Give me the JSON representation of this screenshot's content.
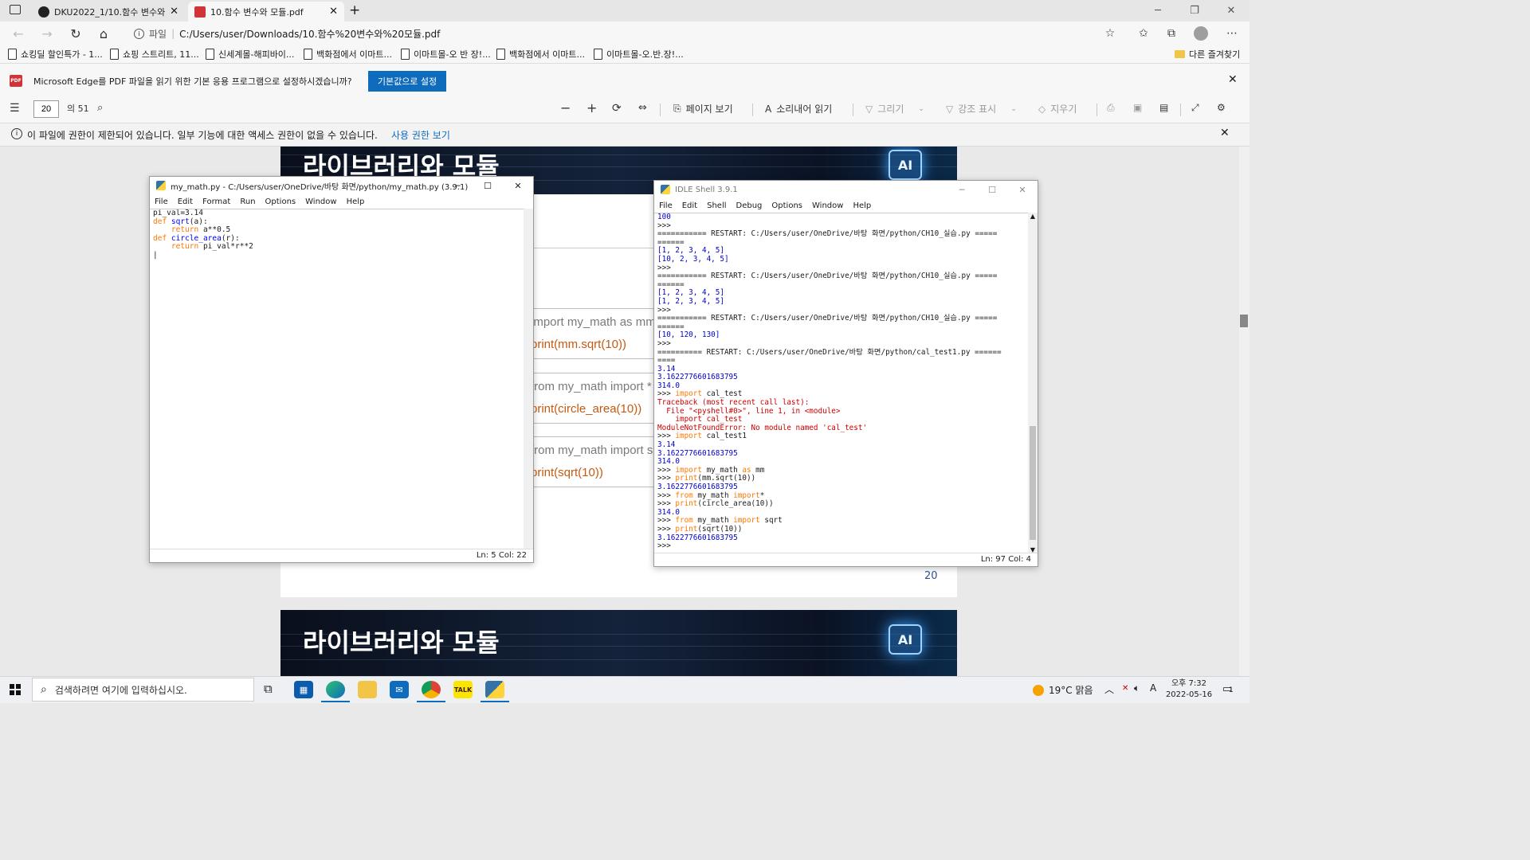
{
  "browser": {
    "tabs": [
      {
        "title": "DKU2022_1/10.함수 변수와 모듈",
        "close": "✕"
      },
      {
        "title": "10.함수 변수와 모듈.pdf",
        "close": "✕"
      }
    ],
    "new_tab": "+",
    "address": {
      "label": "파일",
      "url": "C:/Users/user/Downloads/10.함수%20변수와%20모듈.pdf"
    },
    "bookmarks": [
      "쇼킹딜 할인특가 - 1...",
      "쇼핑 스트리트, 11...",
      "신세계몰-해피바이...",
      "백화점에서 이마트...",
      "이마트몰-오 반 장!...",
      "백화점에서 이마트...",
      "이마트몰-오.반.장!..."
    ],
    "other_favorites": "다른 즐겨찾기",
    "infobar": {
      "message": "Microsoft Edge를 PDF 파일을 읽기 위한 기본 응용 프로그램으로 설정하시겠습니까?",
      "button": "기본값으로 설정",
      "pdf_badge": "PDF"
    }
  },
  "pdf_toolbar": {
    "page_number": "20",
    "page_total": "의 51",
    "page_view": "페이지 보기",
    "read_aloud": "소리내어 읽기",
    "draw": "그리기",
    "highlight": "강조 표시",
    "erase": "지우기"
  },
  "restriction": {
    "message": "이 파일에 권한이 제한되어 있습니다. 일부 기능에 대한 액세스 권한이 없을 수 있습니다.",
    "link": "사용 권한 보기"
  },
  "pdf_page": {
    "banner_title": "라이브러리와 모듈",
    "ai_badge": "AI",
    "code_lines": [
      {
        "a": "import my_math as mm",
        "b": "print(mm.sqrt(10))"
      },
      {
        "a": "from my_math import *",
        "b": "print(circle_area(10))"
      },
      {
        "a": "from my_math import sqrt",
        "b": "print(sqrt(10))"
      }
    ],
    "page_number": "20",
    "next_banner_title": "라이브러리와 모듈",
    "next_ai_badge": "AI"
  },
  "editor": {
    "title": "my_math.py - C:/Users/user/OneDrive/바탕 화면/python/my_math.py (3.9.1)",
    "menu": [
      "File",
      "Edit",
      "Format",
      "Run",
      "Options",
      "Window",
      "Help"
    ],
    "status": "Ln: 5    Col: 22"
  },
  "shell": {
    "title": "IDLE Shell 3.9.1",
    "menu": [
      "File",
      "Edit",
      "Shell",
      "Debug",
      "Options",
      "Window",
      "Help"
    ],
    "status": "Ln: 97    Col: 4"
  },
  "taskbar": {
    "search_placeholder": "검색하려면 여기에 입력하십시오.",
    "weather": "19°C  맑음",
    "time": "오후 7:32",
    "date": "2022-05-16",
    "notification_count": "1"
  }
}
